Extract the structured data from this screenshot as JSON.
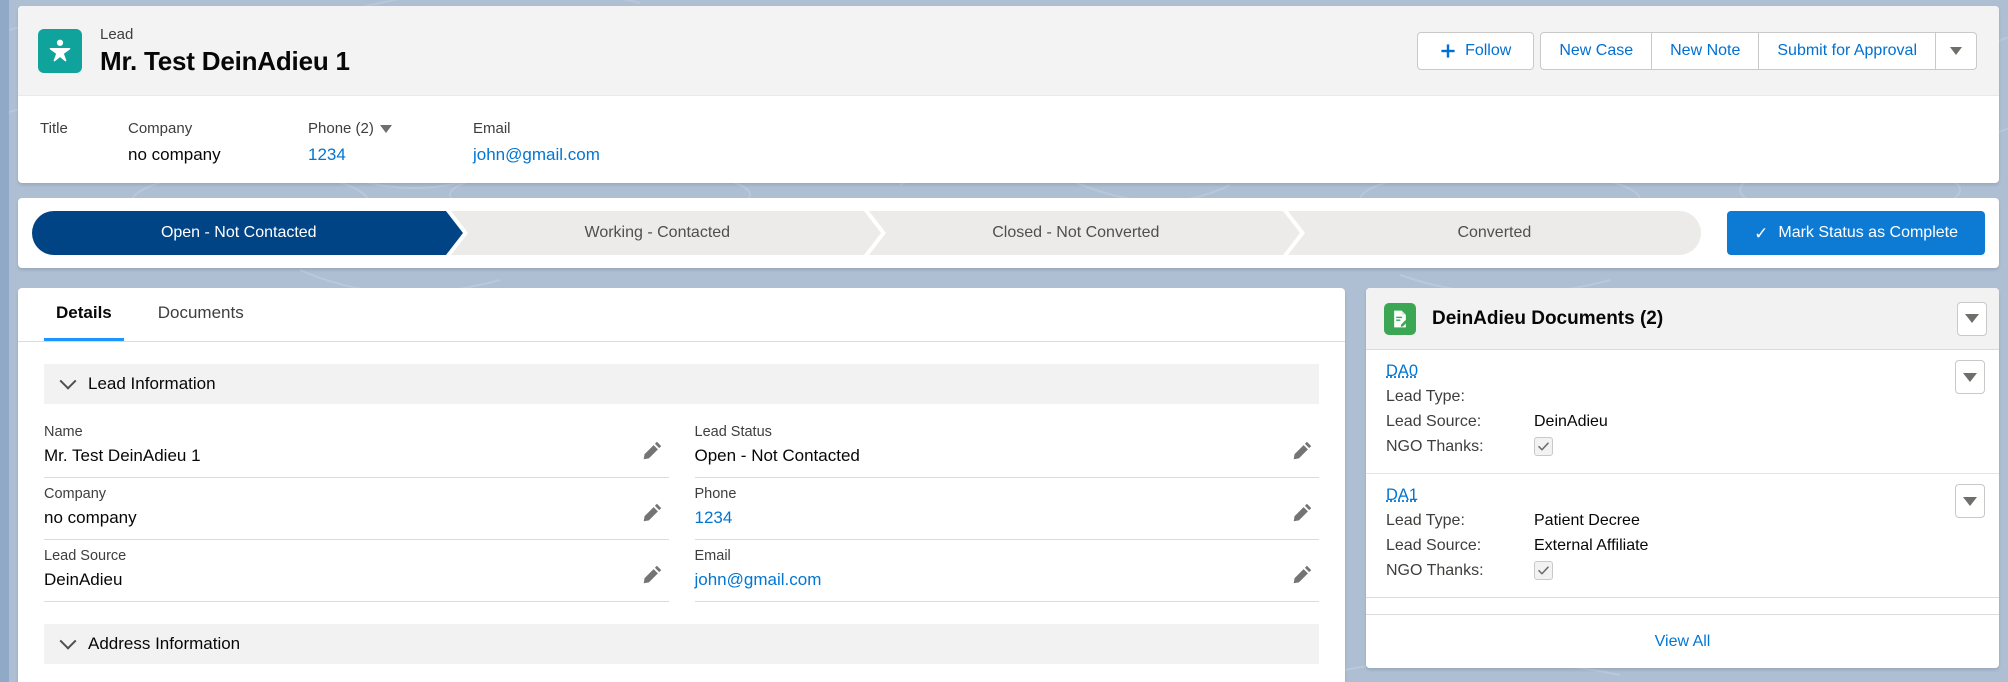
{
  "colors": {
    "lead_icon_bg": "#0fa39b",
    "doc_icon_bg": "#3ba755",
    "link_blue": "#0176d3",
    "path_active": "#014486",
    "brand_button": "#0d7bd4",
    "page_bg": "#aebfd4"
  },
  "highlights": {
    "object_type": "Lead",
    "record_name": "Mr. Test DeinAdieu 1",
    "lead_icon_name": "lead-object-icon",
    "actions": {
      "follow_label": "Follow",
      "new_case_label": "New Case",
      "new_note_label": "New Note",
      "submit_for_approval_label": "Submit for Approval",
      "more_actions_label": ""
    },
    "compact_fields": [
      {
        "label": "Title",
        "value": "",
        "is_link": false,
        "has_caret": false
      },
      {
        "label": "Company",
        "value": "no company",
        "is_link": false,
        "has_caret": false
      },
      {
        "label": "Phone (2)",
        "value": "1234",
        "is_link": true,
        "has_caret": true
      },
      {
        "label": "Email",
        "value": "john@gmail.com",
        "is_link": true,
        "has_caret": false
      }
    ]
  },
  "path": {
    "stages": [
      {
        "label": "Open - Not Contacted",
        "state": "current"
      },
      {
        "label": "Working - Contacted",
        "state": "incomplete"
      },
      {
        "label": "Closed - Not Converted",
        "state": "incomplete"
      },
      {
        "label": "Converted",
        "state": "incomplete"
      }
    ],
    "mark_complete_label": "Mark Status as Complete"
  },
  "detail": {
    "tabs": [
      {
        "label": "Details",
        "active": true
      },
      {
        "label": "Documents",
        "active": false
      }
    ],
    "sections": [
      {
        "title": "Lead Information",
        "expanded": true
      },
      {
        "title": "Address Information",
        "expanded": true
      }
    ],
    "fields": [
      {
        "label": "Name",
        "value": "Mr. Test DeinAdieu 1",
        "is_link": false,
        "column": "left"
      },
      {
        "label": "Lead Status",
        "value": "Open - Not Contacted",
        "is_link": false,
        "column": "right"
      },
      {
        "label": "Company",
        "value": "no company",
        "is_link": false,
        "column": "left"
      },
      {
        "label": "Phone",
        "value": "1234",
        "is_link": true,
        "column": "right"
      },
      {
        "label": "Lead Source",
        "value": "DeinAdieu",
        "is_link": false,
        "column": "left"
      },
      {
        "label": "Email",
        "value": "john@gmail.com",
        "is_link": true,
        "column": "right"
      }
    ]
  },
  "related_list": {
    "title": "DeinAdieu Documents (2)",
    "icon_name": "document-object-icon",
    "view_all_label": "View All",
    "records": [
      {
        "name": "DA0",
        "rows": [
          {
            "key": "Lead Type:",
            "value": ""
          },
          {
            "key": "Lead Source:",
            "value": "DeinAdieu"
          }
        ],
        "checkbox_label": "NGO Thanks:",
        "checkbox_checked": true
      },
      {
        "name": "DA1",
        "rows": [
          {
            "key": "Lead Type:",
            "value": "Patient Decree"
          },
          {
            "key": "Lead Source:",
            "value": "External Affiliate"
          }
        ],
        "checkbox_label": "NGO Thanks:",
        "checkbox_checked": true
      }
    ]
  }
}
